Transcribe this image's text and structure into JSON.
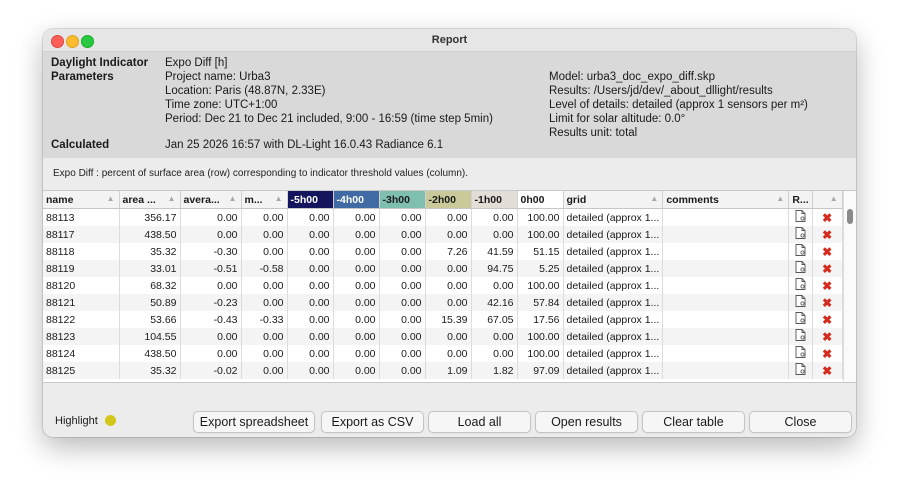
{
  "window": {
    "title": "Report"
  },
  "info": {
    "indicator_label": "Daylight Indicator",
    "indicator_value": "Expo Diff [h]",
    "parameters_label": "Parameters",
    "params_left": [
      "Project name: Urba3",
      "Location: Paris (48.87N, 2.33E)",
      "Time zone: UTC+1:00",
      "Period: Dec 21 to Dec 21 included, 9:00 - 16:59 (time step 5min)"
    ],
    "params_right": [
      "Model: urba3_doc_expo_diff.skp",
      "Results: /Users/jd/dev/_about_dllight/results",
      "Level of details: detailed (approx 1 sensors per m²)",
      "Limit for solar altitude: 0.0°",
      "Results unit: total"
    ],
    "calculated_label": "Calculated",
    "calculated_value": "Jan 25 2026 16:57 with DL-Light 16.0.43 Radiance 6.1"
  },
  "note": "Expo Diff : percent of surface area (row) corresponding to indicator threshold values (column).",
  "table": {
    "columns": [
      {
        "label": "name",
        "bg": "#f3f3f3",
        "fg": "#1a1a1a",
        "sort": true
      },
      {
        "label": "area ...",
        "bg": "#f3f3f3",
        "fg": "#1a1a1a",
        "sort": true
      },
      {
        "label": "avera...",
        "bg": "#f3f3f3",
        "fg": "#1a1a1a",
        "sort": true
      },
      {
        "label": "m...",
        "bg": "#f3f3f3",
        "fg": "#1a1a1a",
        "sort": true
      },
      {
        "label": "-5h00",
        "bg": "#15155e",
        "fg": "#ffffff",
        "sort": false
      },
      {
        "label": "-4h00",
        "bg": "#3f6aa3",
        "fg": "#ffffff",
        "sort": false
      },
      {
        "label": "-3h00",
        "bg": "#7fbfb0",
        "fg": "#1a1a1a",
        "sort": false
      },
      {
        "label": "-2h00",
        "bg": "#c9c99a",
        "fg": "#1a1a1a",
        "sort": false
      },
      {
        "label": "-1h00",
        "bg": "#e2ddd7",
        "fg": "#1a1a1a",
        "sort": false
      },
      {
        "label": "0h00",
        "bg": "#ffffff",
        "fg": "#1a1a1a",
        "sort": false
      },
      {
        "label": "grid",
        "bg": "#f3f3f3",
        "fg": "#1a1a1a",
        "sort": true
      },
      {
        "label": "comments",
        "bg": "#f3f3f3",
        "fg": "#1a1a1a",
        "sort": true
      },
      {
        "label": "R...",
        "bg": "#f3f3f3",
        "fg": "#1a1a1a",
        "sort": false
      },
      {
        "label": "",
        "bg": "#f3f3f3",
        "fg": "#1a1a1a",
        "sort": true
      }
    ],
    "rows": [
      [
        "88113",
        "356.17",
        "0.00",
        "0.00",
        "0.00",
        "0.00",
        "0.00",
        "0.00",
        "0.00",
        "100.00",
        "detailed (approx 1...",
        ""
      ],
      [
        "88117",
        "438.50",
        "0.00",
        "0.00",
        "0.00",
        "0.00",
        "0.00",
        "0.00",
        "0.00",
        "100.00",
        "detailed (approx 1...",
        ""
      ],
      [
        "88118",
        "35.32",
        "-0.30",
        "0.00",
        "0.00",
        "0.00",
        "0.00",
        "7.26",
        "41.59",
        "51.15",
        "detailed (approx 1...",
        ""
      ],
      [
        "88119",
        "33.01",
        "-0.51",
        "-0.58",
        "0.00",
        "0.00",
        "0.00",
        "0.00",
        "94.75",
        "5.25",
        "detailed (approx 1...",
        ""
      ],
      [
        "88120",
        "68.32",
        "0.00",
        "0.00",
        "0.00",
        "0.00",
        "0.00",
        "0.00",
        "0.00",
        "100.00",
        "detailed (approx 1...",
        ""
      ],
      [
        "88121",
        "50.89",
        "-0.23",
        "0.00",
        "0.00",
        "0.00",
        "0.00",
        "0.00",
        "42.16",
        "57.84",
        "detailed (approx 1...",
        ""
      ],
      [
        "88122",
        "53.66",
        "-0.43",
        "-0.33",
        "0.00",
        "0.00",
        "0.00",
        "15.39",
        "67.05",
        "17.56",
        "detailed (approx 1...",
        ""
      ],
      [
        "88123",
        "104.55",
        "0.00",
        "0.00",
        "0.00",
        "0.00",
        "0.00",
        "0.00",
        "0.00",
        "100.00",
        "detailed (approx 1...",
        ""
      ],
      [
        "88124",
        "438.50",
        "0.00",
        "0.00",
        "0.00",
        "0.00",
        "0.00",
        "0.00",
        "0.00",
        "100.00",
        "detailed (approx 1...",
        ""
      ],
      [
        "88125",
        "35.32",
        "-0.02",
        "0.00",
        "0.00",
        "0.00",
        "0.00",
        "1.09",
        "1.82",
        "97.09",
        "detailed (approx 1...",
        ""
      ]
    ]
  },
  "footer": {
    "highlight_label": "Highlight",
    "highlight_color": "#d4c71c",
    "buttons": [
      "Export spreadsheet",
      "Export as CSV",
      "Load all",
      "Open results",
      "Clear table",
      "Close"
    ]
  },
  "icons": {
    "report": "document-icon",
    "delete": "delete-icon"
  }
}
